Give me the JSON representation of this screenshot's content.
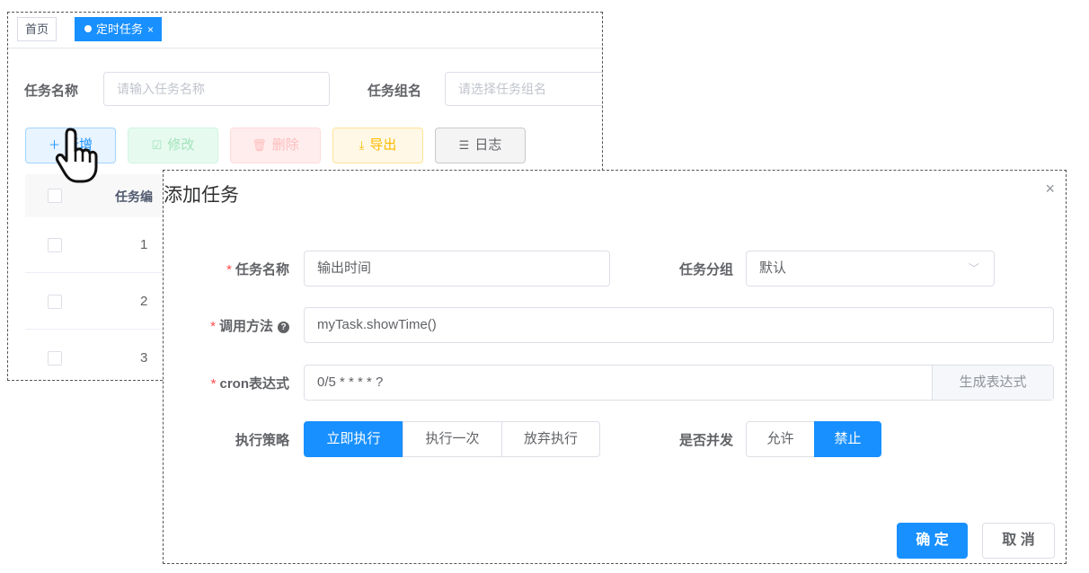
{
  "tabs": {
    "home": "首页",
    "active": "定时任务",
    "close": "×"
  },
  "search": {
    "task_name_label": "任务名称",
    "task_name_placeholder": "请输入任务名称",
    "task_group_label": "任务组名",
    "task_group_placeholder": "请选择任务组名"
  },
  "toolbar": {
    "add": "新增",
    "edit": "修改",
    "delete": "删除",
    "export": "导出",
    "log": "日志"
  },
  "table": {
    "header_id": "任务编",
    "rows": [
      "1",
      "2",
      "3"
    ]
  },
  "dialog": {
    "title": "添加任务",
    "close": "×",
    "task_name_label": "任务名称",
    "task_name_value": "输出时间",
    "task_group_label": "任务分组",
    "task_group_value": "默认",
    "invoke_label": "调用方法",
    "invoke_value": "myTask.showTime()",
    "cron_label": "cron表达式",
    "cron_value": "0/5 * * * * ?",
    "cron_button": "生成表达式",
    "policy_label": "执行策略",
    "policy_options": [
      "立即执行",
      "执行一次",
      "放弃执行"
    ],
    "policy_selected": "立即执行",
    "concurrent_label": "是否并发",
    "concurrent_options": [
      "允许",
      "禁止"
    ],
    "concurrent_selected": "禁止",
    "ok": "确 定",
    "cancel": "取 消"
  },
  "colors": {
    "primary": "#1890ff",
    "required": "#ff4949"
  },
  "icons": {
    "add": "plus-icon",
    "edit": "edit-icon",
    "delete": "trash-icon",
    "export": "download-icon",
    "log": "sliders-icon",
    "cursor": "hand-pointer-icon"
  }
}
